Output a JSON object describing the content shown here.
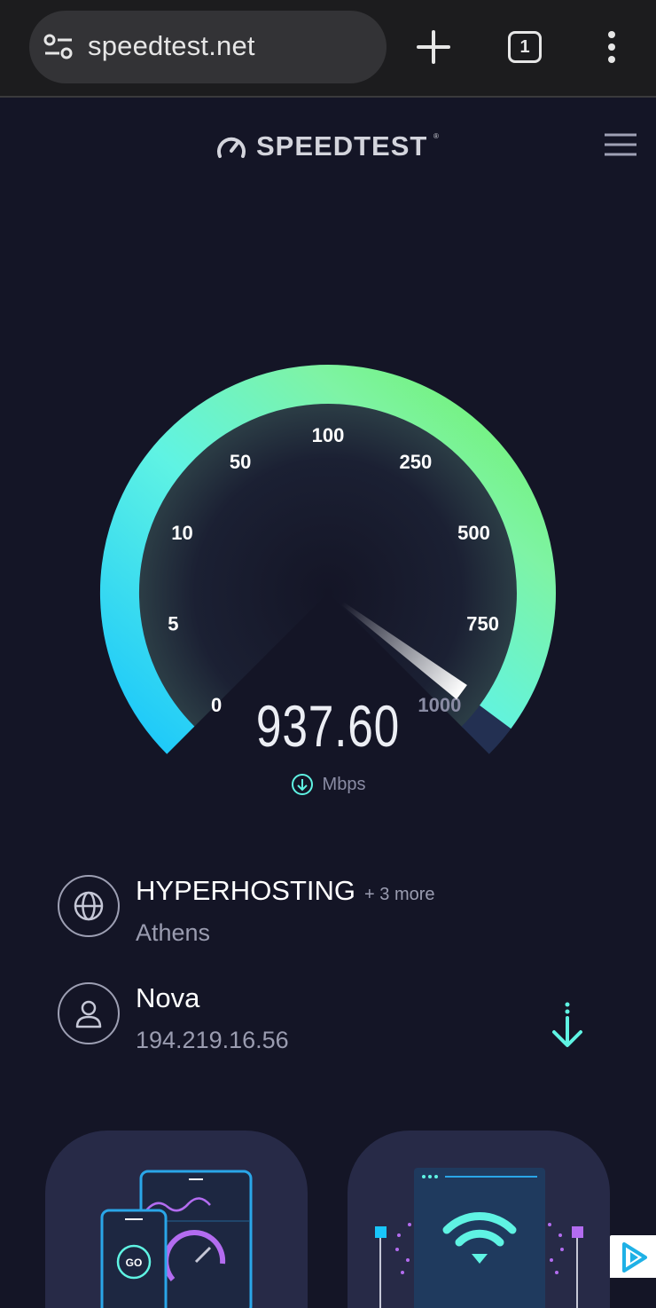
{
  "browser": {
    "url": "speedtest.net",
    "tab_count": "1"
  },
  "header": {
    "brand_name": "SPEEDTEST",
    "brand_tm": "®"
  },
  "gauge": {
    "scale_labels": [
      "0",
      "5",
      "10",
      "50",
      "100",
      "250",
      "500",
      "750",
      "1000"
    ],
    "current_value_mbps": 937.6,
    "max_value_mbps": 1000,
    "gradient_colors": [
      "#19c6fb",
      "#5ff3e3",
      "#7ef3a5",
      "#6ff269"
    ]
  },
  "result": {
    "value": "937.60",
    "unit": "Mbps",
    "direction_icon": "download-circle-icon"
  },
  "server": {
    "name": "HYPERHOSTING",
    "more": "+ 3 more",
    "location": "Athens",
    "icon": "globe-icon"
  },
  "isp": {
    "name": "Nova",
    "ip": "194.219.16.56",
    "icon": "user-icon"
  },
  "promo_cards": [
    {
      "id": "apps",
      "icon": "devices-illustration",
      "button_text": "GO"
    },
    {
      "id": "wifi",
      "icon": "wifi-illustration"
    }
  ],
  "colors": {
    "background": "#141526",
    "accent_cyan": "#5ff3e3",
    "accent_green": "#6ff269",
    "accent_blue": "#19c6fb",
    "card": "#272a47"
  }
}
